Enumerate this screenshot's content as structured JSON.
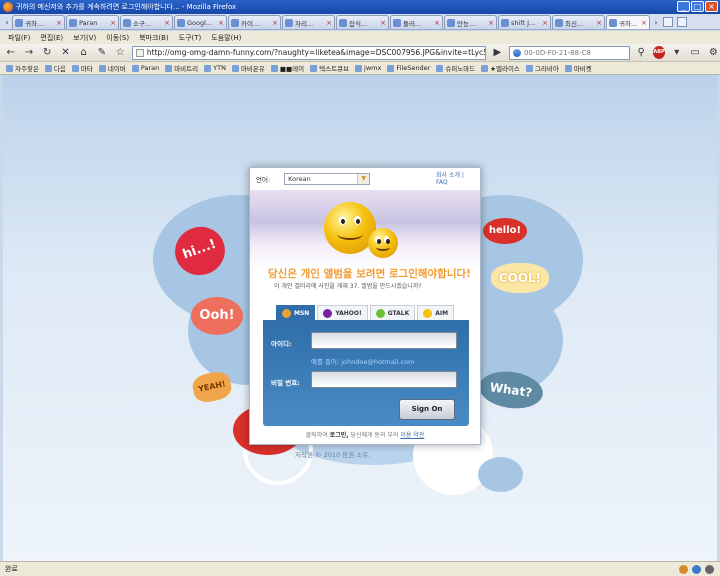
{
  "window": {
    "title": "귀하의 메신저와 추가를 계속하려면 로그인해야합니다... - Mozilla Firefox",
    "minimize": "_",
    "maximize": "□",
    "close": "×"
  },
  "tabs": [
    {
      "label": "귀하..."
    },
    {
      "label": "Paran"
    },
    {
      "label": "소구..."
    },
    {
      "label": "Googl..."
    },
    {
      "label": "카이..."
    },
    {
      "label": "자리..."
    },
    {
      "label": "잡식..."
    },
    {
      "label": "둘러..."
    },
    {
      "label": "만능..."
    },
    {
      "label": "shift J..."
    },
    {
      "label": "최신..."
    },
    {
      "label": "귀하..."
    }
  ],
  "menu": [
    "파일(F)",
    "편집(E)",
    "보기(V)",
    "이동(S)",
    "북마크(B)",
    "도구(T)",
    "도움말(H)"
  ],
  "nav": {
    "url": "http://omg-omg-damn-funny.com/?naughty=liketea&image=DSC007956.JPG&invite=tLyc5dVr",
    "search_value": "00-0D-F0-21-88-C8",
    "abp": "ABP"
  },
  "bookmarks": [
    "자주찾은",
    "다음",
    "마타",
    "네이버",
    "Paran",
    "마비트리",
    "YTN",
    "마비온유",
    "■■레이",
    "텍스트큐브",
    "jwmx",
    "FileSender",
    "슈퍼노마드",
    "★멜라이스",
    "그라비아",
    "마비켓"
  ],
  "bubbles": {
    "hi": "hi...!",
    "ooh": "Ooh!",
    "yeah": "YEAH!",
    "hello": "hello!",
    "cool": "COOL!",
    "what": "What?"
  },
  "dialog": {
    "language_label": "언어:",
    "language_value": "Korean",
    "about_link": "회사 소개 | FAQ",
    "headline": "당신은 개인 앨범을 보려면 로그인해야합니다!",
    "subline": "이 개인 갤러리에 사진을 게재 37. 앨범을 만드시겠습니까?",
    "services": [
      {
        "name": "MSN",
        "color": "#e8a23a"
      },
      {
        "name": "YAHOO!",
        "color": "#7b1fa2"
      },
      {
        "name": "GTALK",
        "color": "#6cbf3a"
      },
      {
        "name": "AIM",
        "color": "#f6c00d"
      }
    ],
    "id_label": "아이디:",
    "example_hint": "예를 들어: johndoe@hotmail.com",
    "password_label": "비밀 번호:",
    "sign_on": "Sign On",
    "terms_prefix": "클릭하여",
    "terms_bold": "로그인,",
    "terms_middle": "당신에게 동의 부의",
    "terms_link": "이용 약관"
  },
  "copyright": "저작권 © 2010 판권 소유.",
  "status": "완료"
}
